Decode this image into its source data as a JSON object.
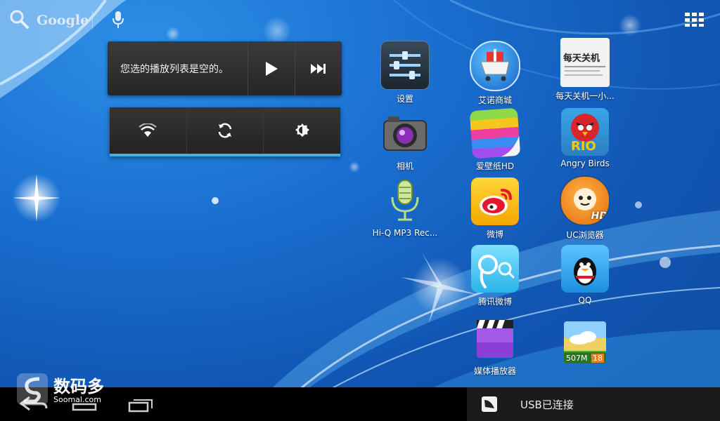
{
  "search": {
    "label": "Google"
  },
  "music_widget": {
    "status": "您选的播放列表是空的。"
  },
  "apps": [
    {
      "label": "设置",
      "icon": "settings-icon"
    },
    {
      "label": "艾诺商城",
      "icon": "store-cart-icon"
    },
    {
      "label": "每天关机一小...",
      "icon": "daily-shutdown-icon",
      "icon_text": "每天关机"
    },
    {
      "label": "相机",
      "icon": "camera-icon"
    },
    {
      "label": "爱壁纸HD",
      "icon": "wallpaper-icon"
    },
    {
      "label": "Angry Birds",
      "icon": "angry-birds-icon",
      "icon_text": "RIO"
    },
    {
      "label": "Hi-Q MP3 Rec...",
      "icon": "microphone-icon"
    },
    {
      "label": "微博",
      "icon": "weibo-icon"
    },
    {
      "label": "UC浏览器",
      "icon": "uc-browser-icon",
      "icon_text": "HD"
    },
    {
      "label": "腾讯微博",
      "icon": "tencent-weibo-icon"
    },
    {
      "label": "QQ",
      "icon": "qq-icon"
    },
    {
      "label": "媒体播放器",
      "icon": "media-player-icon"
    },
    {
      "label": "",
      "icon": "memory-cleaner-icon",
      "icon_text": "507M"
    }
  ],
  "memory_widget": {
    "value": "507M",
    "count": "18"
  },
  "status_bar": {
    "notification": "USB已连接"
  },
  "watermark": {
    "cn": "数码多",
    "en": "Soomal.com"
  },
  "colors": {
    "accent": "#45b0e8",
    "navbar": "#000000"
  }
}
